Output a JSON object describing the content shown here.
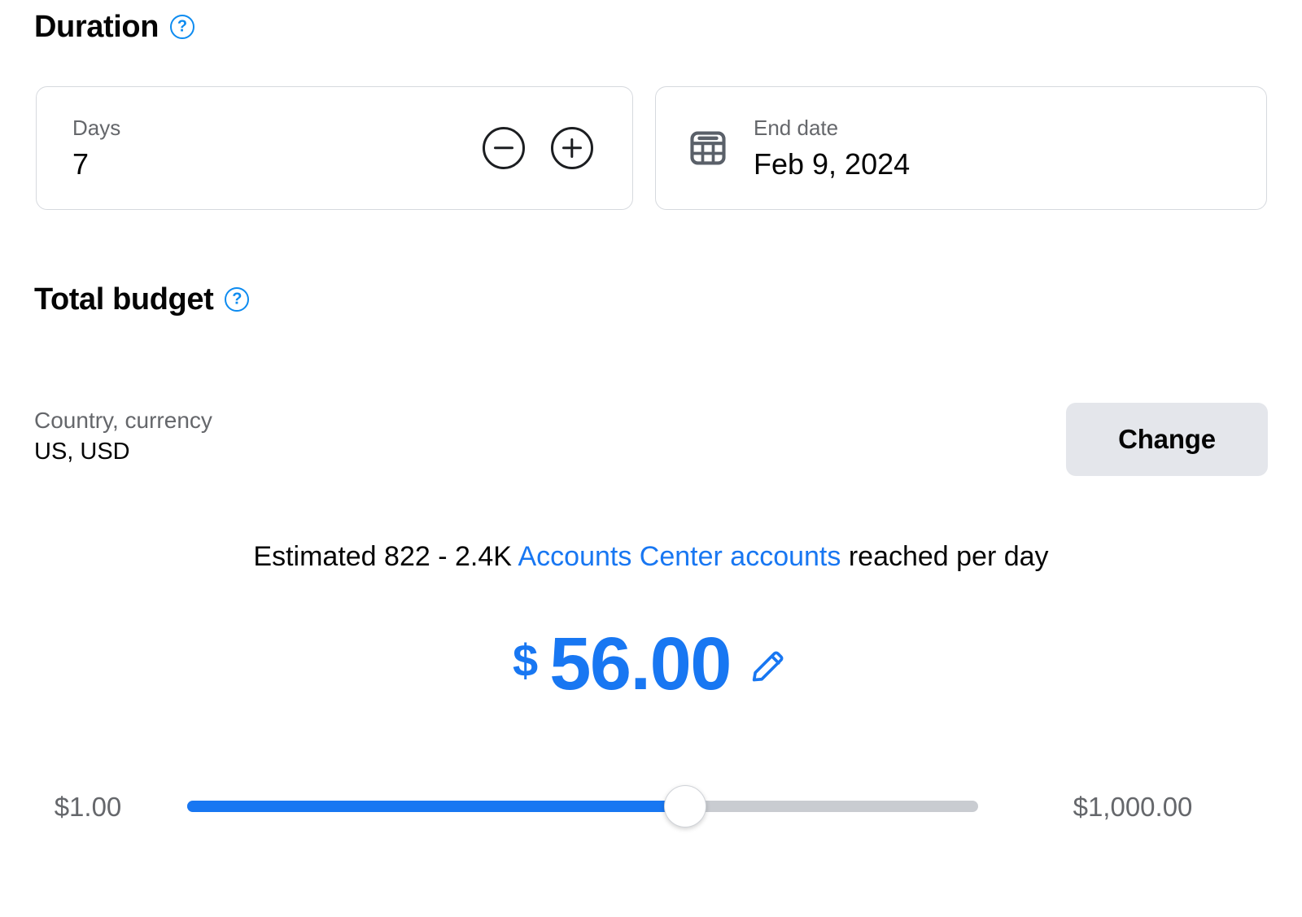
{
  "duration": {
    "heading": "Duration",
    "help_icon": "question-circle-icon",
    "days_field": {
      "label": "Days",
      "value": "7",
      "decrement_icon": "minus-circle-icon",
      "increment_icon": "plus-circle-icon"
    },
    "end_date_field": {
      "icon": "calendar-icon",
      "label": "End date",
      "value": "Feb 9, 2024"
    }
  },
  "total_budget": {
    "heading": "Total budget",
    "help_icon": "question-circle-icon",
    "country_currency": {
      "label": "Country, currency",
      "value": "US, USD"
    },
    "change_button_label": "Change",
    "estimate": {
      "prefix": "Estimated 822 - 2.4K ",
      "link_text": "Accounts Center accounts",
      "suffix": " reached per day"
    },
    "amount": {
      "currency_symbol": "$",
      "value": "56.00",
      "edit_icon": "pencil-icon"
    },
    "slider": {
      "min_label": "$1.00",
      "max_label": "$1,000.00",
      "min_value": 1,
      "max_value": 1000,
      "current_value": 56,
      "fill_percent": 63,
      "thumb_percent": 63
    }
  },
  "colors": {
    "accent_blue": "#1877f2",
    "link_blue": "#1877f2",
    "help_blue": "#0d8bf0",
    "text_primary": "#050505",
    "text_secondary": "#65676b",
    "card_border": "#d6d9de",
    "button_bg": "#e4e6eb",
    "track_gray": "#c9ccd1"
  }
}
